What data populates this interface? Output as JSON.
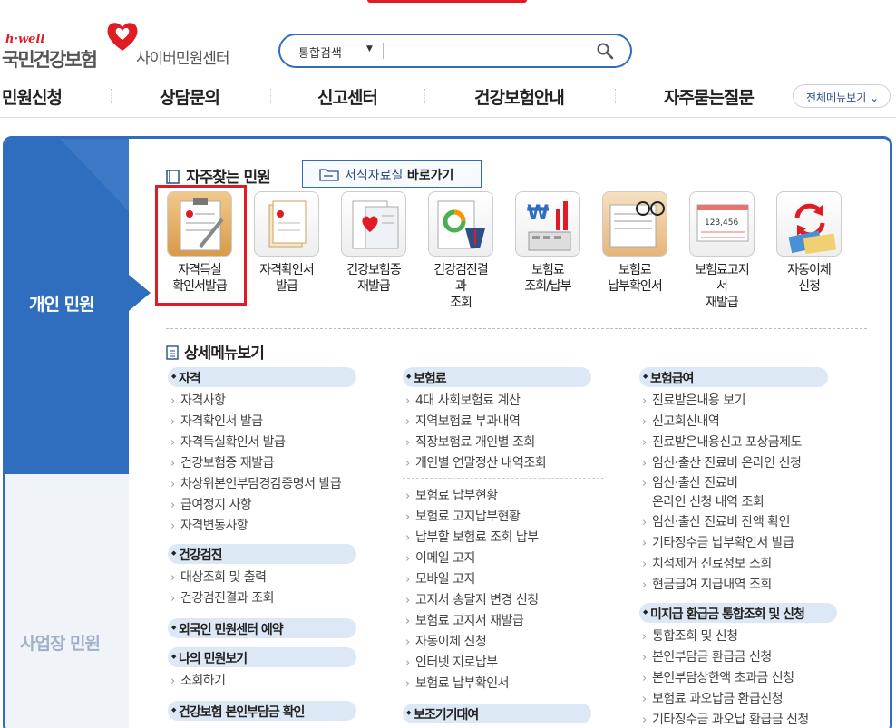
{
  "header": {
    "logo_hwell": "h·well",
    "logo_nhis": "국민건강보험",
    "logo_cyber": "사이버민원센터",
    "search_select": "통합검색",
    "search_placeholder": ""
  },
  "nav": {
    "items": [
      "민원신청",
      "상담문의",
      "신고센터",
      "건강보험안내",
      "자주묻는질문"
    ],
    "all_menu": "전체메뉴보기"
  },
  "sidebar": {
    "personal": "개인 민원",
    "business": "사업장 민원"
  },
  "frequent": {
    "title": "자주찾는 민원",
    "forms_button_prefix": "서식자료실",
    "forms_button_suffix": "바로가기",
    "tiles": [
      {
        "label": "자격득실\n확인서발급",
        "icon": "clipboard-pen-icon"
      },
      {
        "label": "자격확인서\n발급",
        "icon": "document-icon"
      },
      {
        "label": "건강보험증\n재발급",
        "icon": "insurance-card-icon"
      },
      {
        "label": "건강검진결\n과\n조회",
        "icon": "checkup-chart-icon"
      },
      {
        "label": "보험료\n조회/납부",
        "icon": "won-calculator-icon"
      },
      {
        "label": "보험료\n납부확인서",
        "icon": "receipt-glasses-icon"
      },
      {
        "label": "보험료고지\n서\n재발급",
        "icon": "bill-notice-icon"
      },
      {
        "label": "자동이체\n신청",
        "icon": "auto-transfer-icon"
      }
    ]
  },
  "detail": {
    "title": "상세메뉴보기",
    "col1": [
      {
        "cat": "자격",
        "links": [
          "자격사항",
          "자격확인서 발급",
          "자격득실확인서 발급",
          "건강보험증 재발급",
          "차상위본인부담경감증명서 발급",
          "급여정지 사항",
          "자격변동사항"
        ]
      },
      {
        "cat": "건강검진",
        "links": [
          "대상조회 및 출력",
          "건강검진결과 조회"
        ]
      },
      {
        "cat": "외국인 민원센터 예약",
        "links": []
      },
      {
        "cat": "나의 민원보기",
        "links": [
          "조회하기"
        ]
      },
      {
        "cat": "건강보험 본인부담금 확인",
        "links": []
      }
    ],
    "col2": [
      {
        "cat": "보험료",
        "links": [
          "4대 사회보험료 계산",
          "지역보험료 부과내역",
          "직장보험료 개인별 조회",
          "개인별 연말정산 내역조회"
        ]
      },
      {
        "cat": "",
        "links": [
          "보험료 납부현황",
          "보험료 고지납부현황",
          "납부할 보험료 조회 납부",
          "이메일 고지",
          "모바일 고지",
          "고지서 송달지 변경 신청",
          "보험료 고지서 재발급",
          "자동이체 신청",
          "인터넷 지로납부",
          "보험료 납부확인서"
        ]
      },
      {
        "cat": "보조기기대여",
        "links": []
      }
    ],
    "col3": [
      {
        "cat": "보험급여",
        "links": [
          "진료받은내용 보기",
          "신고회신내역",
          "진료받은내용신고 포상금제도",
          "임신·출산 진료비 온라인 신청",
          "임신·출산 진료비\n온라인 신청 내역 조회",
          "임신·출산 진료비 잔액 확인",
          "기타징수금 납부확인서 발급",
          "치석제거 진료정보 조회",
          "현금급여 지급내역 조회"
        ]
      },
      {
        "cat": "미지급 환급금 통합조회 및 신청",
        "links": [
          "통합조회 및 신청",
          "본인부담금 환급금 신청",
          "본인부담상한액 초과금 신청",
          "보험료 과오납금 환급신청",
          "기타징수금 과오납 환급금 신청"
        ]
      }
    ]
  },
  "colors": {
    "brand_blue": "#2f6dbf",
    "brand_red": "#e01b24",
    "cat_bg": "#dde8f6"
  }
}
